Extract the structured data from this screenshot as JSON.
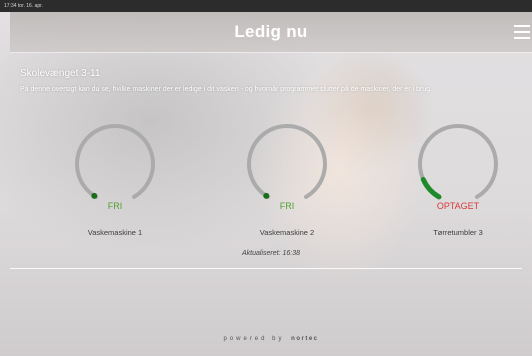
{
  "device": {
    "status_text": "17:34  tor. 16. apr."
  },
  "header": {
    "title": "Ledig nu",
    "menu_icon": "hamburger-icon"
  },
  "location": "Skolevænget 3-11",
  "description": "På denne oversigt kan du se, hvilke maskiner der er ledige i dit vaskeri - og hvornår programmet slutter på de maskiner, der er i brug.",
  "machines": [
    {
      "name": "Vaskemaskine 1",
      "status": "FRI",
      "progress": 0.0,
      "status_color": "#4fa030"
    },
    {
      "name": "Vaskemaskine 2",
      "status": "FRI",
      "progress": 0.0,
      "status_color": "#4fa030"
    },
    {
      "name": "Tørretumbler 3",
      "status": "OPTAGET",
      "progress": 0.12,
      "status_color": "#d63a3a"
    }
  ],
  "updated_text": "Aktualiseret: 16:38",
  "footer": {
    "powered_by": "powered by",
    "brand": "nortec"
  },
  "colors": {
    "ring": "#ababab",
    "ring_active": "#1f8a2a",
    "free": "#4fa030",
    "busy": "#d63a3a",
    "header_text": "#ffffff"
  }
}
